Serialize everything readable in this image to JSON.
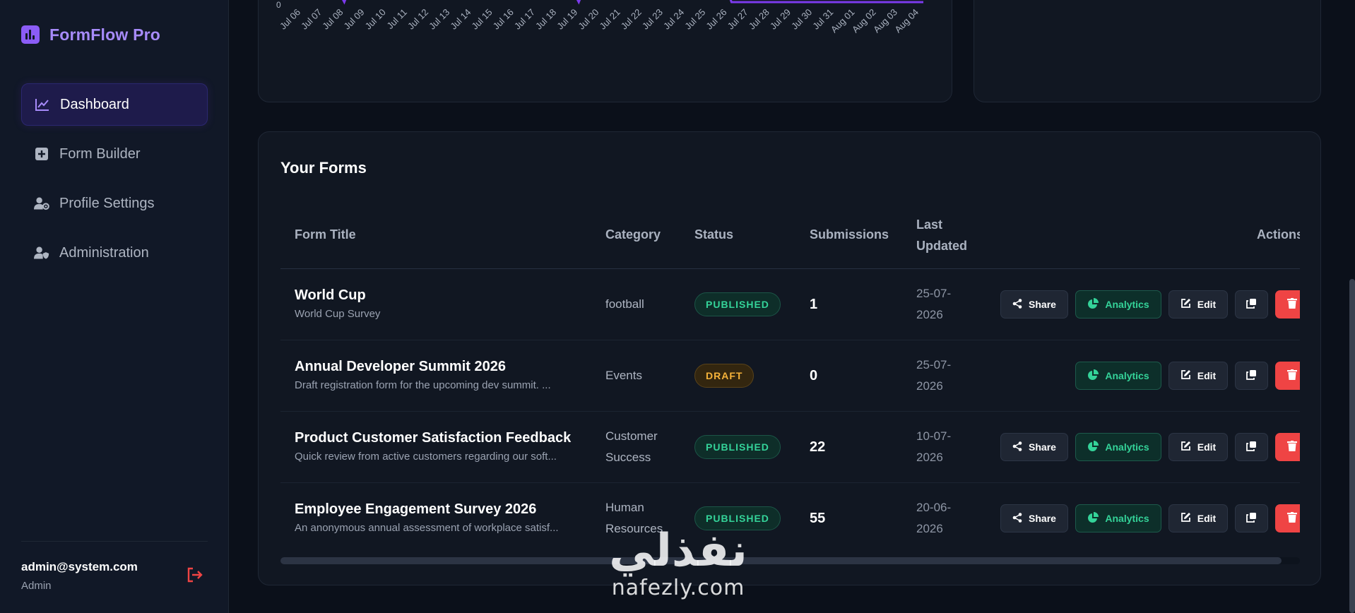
{
  "app": {
    "name": "FormFlow Pro"
  },
  "sidebar": {
    "items": [
      {
        "label": "Dashboard",
        "icon": "chart-line-icon",
        "active": true
      },
      {
        "label": "Form Builder",
        "icon": "plus-square-icon",
        "active": false
      },
      {
        "label": "Profile Settings",
        "icon": "user-gear-icon",
        "active": false
      },
      {
        "label": "Administration",
        "icon": "user-shield-icon",
        "active": false
      }
    ],
    "user": {
      "email": "admin@system.com",
      "role": "Admin"
    }
  },
  "chart_data": {
    "type": "line",
    "x": [
      "Jul 06",
      "Jul 07",
      "Jul 08",
      "Jul 09",
      "Jul 10",
      "Jul 11",
      "Jul 12",
      "Jul 13",
      "Jul 14",
      "Jul 15",
      "Jul 16",
      "Jul 17",
      "Jul 18",
      "Jul 19",
      "Jul 20",
      "Jul 21",
      "Jul 22",
      "Jul 23",
      "Jul 24",
      "Jul 25",
      "Jul 26",
      "Jul 27",
      "Jul 28",
      "Jul 29",
      "Jul 30",
      "Jul 31",
      "Aug 01",
      "Aug 02",
      "Aug 03",
      "Aug 04"
    ],
    "y_tick_visible": "0",
    "series_color": "#7c3aed"
  },
  "forms": {
    "title": "Your Forms",
    "columns": {
      "title": "Form Title",
      "category": "Category",
      "status": "Status",
      "submissions": "Submissions",
      "updated_line1": "Last",
      "updated_line2": "Updated",
      "actions": "Actions"
    },
    "actions": {
      "share": "Share",
      "analytics": "Analytics",
      "edit": "Edit"
    },
    "rows": [
      {
        "title": "World Cup",
        "desc": "World Cup Survey",
        "category_line1": "football",
        "category_line2": "",
        "status": "PUBLISHED",
        "submissions": "1",
        "updated_line1": "25-07-",
        "updated_line2": "2026"
      },
      {
        "title": "Annual Developer Summit 2026",
        "desc": "Draft registration form for the upcoming dev summit. ...",
        "category_line1": "Events",
        "category_line2": "",
        "status": "DRAFT",
        "submissions": "0",
        "updated_line1": "25-07-",
        "updated_line2": "2026"
      },
      {
        "title": "Product Customer Satisfaction Feedback",
        "desc": "Quick review from active customers regarding our soft...",
        "category_line1": "Customer",
        "category_line2": "Success",
        "status": "PUBLISHED",
        "submissions": "22",
        "updated_line1": "10-07-",
        "updated_line2": "2026"
      },
      {
        "title": "Employee Engagement Survey 2026",
        "desc": "An anonymous annual assessment of workplace satisf...",
        "category_line1": "Human",
        "category_line2": "Resources",
        "status": "PUBLISHED",
        "submissions": "55",
        "updated_line1": "20-06-",
        "updated_line2": "2026"
      }
    ]
  },
  "watermark": {
    "arabic": "نفذلي",
    "latin": "nafezly.com"
  },
  "colors": {
    "accent": "#8b5cf6",
    "published": "#34d399",
    "draft": "#f5b23a",
    "danger": "#ef4444"
  }
}
